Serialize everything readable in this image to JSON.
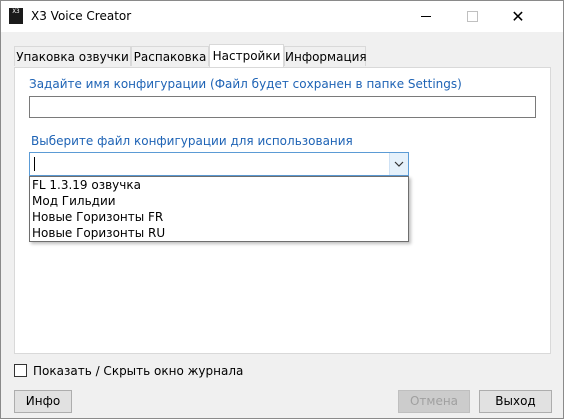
{
  "window": {
    "title": "X3 Voice Creator",
    "icon_text": "X3"
  },
  "titlebar_buttons": {
    "close_glyph": "✕"
  },
  "tabs": [
    {
      "label": "Упаковка озвучки",
      "active": false
    },
    {
      "label": "Распаковка",
      "active": false
    },
    {
      "label": "Настройки",
      "active": true
    },
    {
      "label": "Информация",
      "active": false
    }
  ],
  "settings": {
    "config_name_label": "Задайте имя конфигурации (Файл будет сохранен в папке Settings)",
    "config_name_value": "",
    "choose_config_label": "Выберите файл конфигурации для использования",
    "selected_config": "",
    "options": [
      "FL 1.3.19 озвучка",
      "Мод Гильдии",
      "Новые Горизонты FR",
      "Новые Горизонты RU"
    ]
  },
  "footer": {
    "log_toggle_label": "Показать / Скрыть окно журнала",
    "log_toggle_checked": false,
    "info_button": "Инфо",
    "cancel_button": "Отмена",
    "exit_button": "Выход"
  },
  "colors": {
    "label_accent": "#1e63b5",
    "focus_border": "#5b9bd5"
  }
}
